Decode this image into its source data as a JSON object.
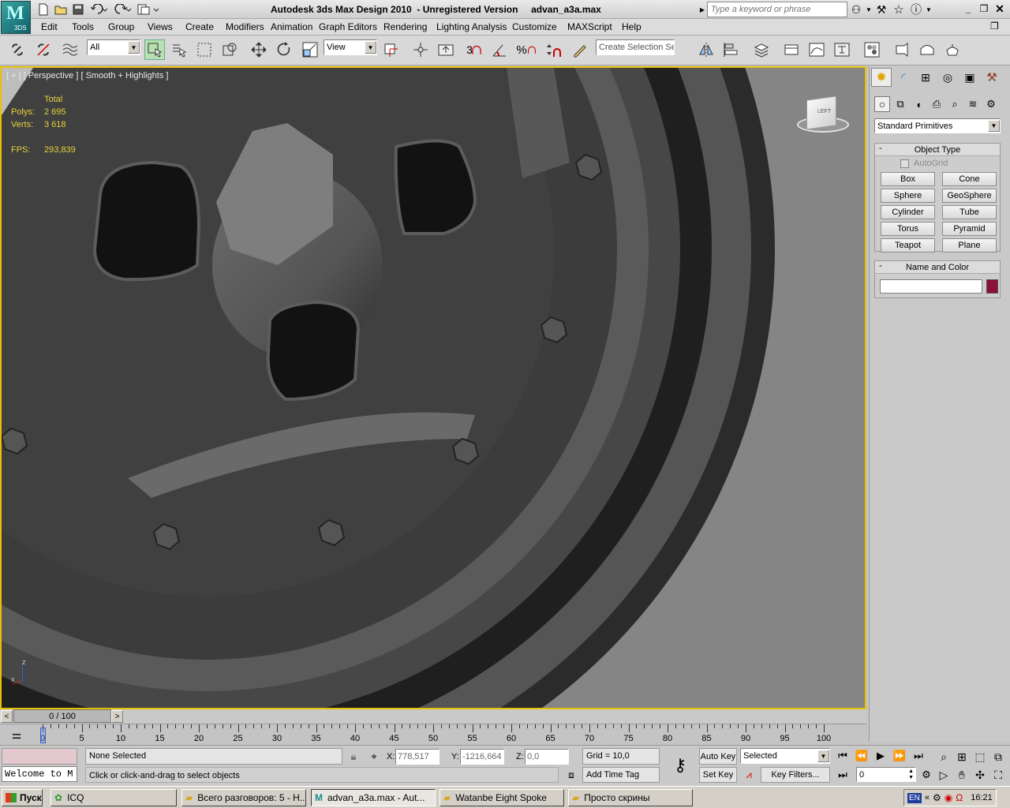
{
  "titlebar": {
    "app_title": "Autodesk 3ds Max Design 2010  - Unregistered Version     advan_a3a.max",
    "logo_text": "3DS",
    "search_placeholder": "Type a keyword or phrase"
  },
  "menu": [
    "Edit",
    "Tools",
    "Group",
    "Views",
    "Create",
    "Modifiers",
    "Animation",
    "Graph Editors",
    "Rendering",
    "Lighting Analysis",
    "Customize",
    "MAXScript",
    "Help"
  ],
  "toolbar": {
    "filter_value": "All",
    "refcoord_value": "View",
    "selection_set_placeholder": "Create Selection Se",
    "snap_label": "3",
    "percent_label": "%"
  },
  "viewport": {
    "label": "[ + ] [ Perspective ] [ Smooth + Highlights ]",
    "stats": {
      "total_label": "Total",
      "polys_label": "Polys:",
      "polys_value": "2 695",
      "verts_label": "Verts:",
      "verts_value": "3 618",
      "fps_label": "FPS:",
      "fps_value": "293,839"
    },
    "viewcube_label": "LEFT",
    "axis_z": "z",
    "axis_x": "x"
  },
  "command_panel": {
    "dropdown_value": "Standard Primitives",
    "object_type_title": "Object Type",
    "autogrid_label": "AutoGrid",
    "buttons": [
      "Box",
      "Cone",
      "Sphere",
      "GeoSphere",
      "Cylinder",
      "Tube",
      "Torus",
      "Pyramid",
      "Teapot",
      "Plane"
    ],
    "name_color_title": "Name and Color",
    "name_value": "",
    "color_swatch": "#8e0e3a"
  },
  "timeline": {
    "frame_display": "0 / 100",
    "ticks": [
      "0",
      "5",
      "10",
      "15",
      "20",
      "25",
      "30",
      "35",
      "40",
      "45",
      "50",
      "55",
      "60",
      "65",
      "70",
      "75",
      "80",
      "85",
      "90",
      "95",
      "100"
    ]
  },
  "status": {
    "maxscript_text": "Welcome to M",
    "selection_status": "None Selected",
    "prompt": "Click or click-and-drag to select objects",
    "x_label": "X:",
    "x_value": "778,517",
    "y_label": "Y:",
    "y_value": "-1216,664",
    "z_label": "Z:",
    "z_value": "0,0",
    "grid": "Grid = 10,0",
    "add_time_tag": "Add Time Tag",
    "auto_key": "Auto Key",
    "set_key": "Set Key",
    "key_mode_value": "Selected",
    "key_filters": "Key Filters...",
    "current_frame": "0"
  },
  "taskbar": {
    "start": "Пуск",
    "tasks": [
      "ICQ",
      "Всего разговоров: 5 - H...",
      "advan_a3a.max - Aut...",
      "Watanbe Eight Spoke",
      "Просто скрины"
    ],
    "lang": "EN",
    "clock": "16:21"
  },
  "colors": {
    "viewport_border": "#e8c200",
    "stats_text": "#e6d23a"
  }
}
